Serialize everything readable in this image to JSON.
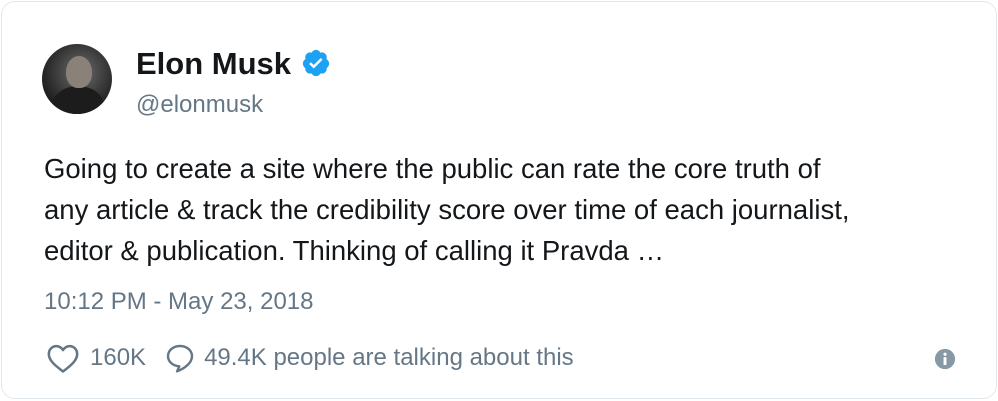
{
  "tweet": {
    "author": {
      "name": "Elon Musk",
      "handle": "@elonmusk",
      "verified": true
    },
    "text_lines": [
      "Going to create a site where the public can rate the core truth of",
      "any article & track the credibility score over time of each journalist,",
      "editor & publication. Thinking of calling it Pravda …"
    ],
    "timestamp": "10:12 PM - May 23, 2018",
    "like_count": "160K",
    "talking_text": "49.4K people are talking about this"
  },
  "icons": {
    "like": "heart-icon",
    "reply": "reply-icon",
    "info": "info-icon",
    "verified": "verified-badge-icon"
  },
  "colors": {
    "text": "#14171a",
    "secondary": "#657786",
    "verified": "#1da1f2",
    "border": "#e1e8ed"
  }
}
